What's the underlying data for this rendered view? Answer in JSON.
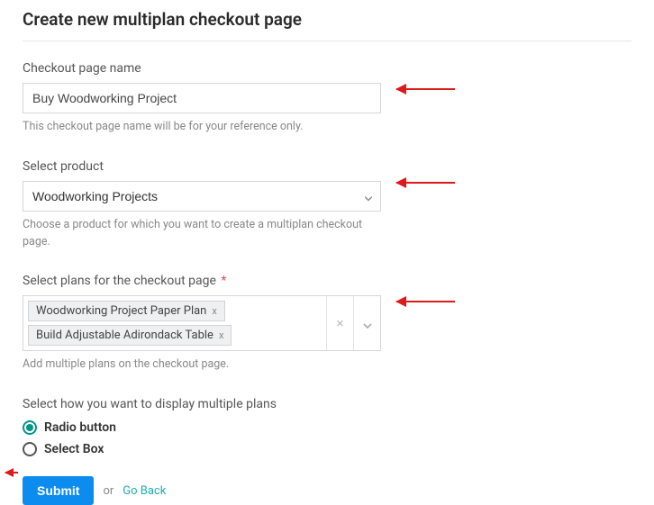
{
  "title": "Create new multiplan checkout page",
  "fields": {
    "name": {
      "label": "Checkout page name",
      "value": "Buy Woodworking Project",
      "helper": "This checkout page name will be for your reference only."
    },
    "product": {
      "label": "Select product",
      "value": "Woodworking Projects",
      "helper": "Choose a product for which you want to create a multiplan checkout page."
    },
    "plans": {
      "label": "Select plans for the checkout page",
      "required": "*",
      "chips": [
        "Woodworking Project Paper Plan",
        "Build Adjustable Adirondack Table"
      ],
      "helper": "Add multiple plans on the checkout page."
    },
    "display": {
      "label": "Select how you want to display multiple plans",
      "options": [
        "Radio button",
        "Select Box"
      ],
      "selectedIndex": 0
    }
  },
  "actions": {
    "submit": "Submit",
    "or": "or",
    "goback": "Go Back"
  },
  "icons": {
    "chip_x": "x",
    "clear_x": "×"
  }
}
